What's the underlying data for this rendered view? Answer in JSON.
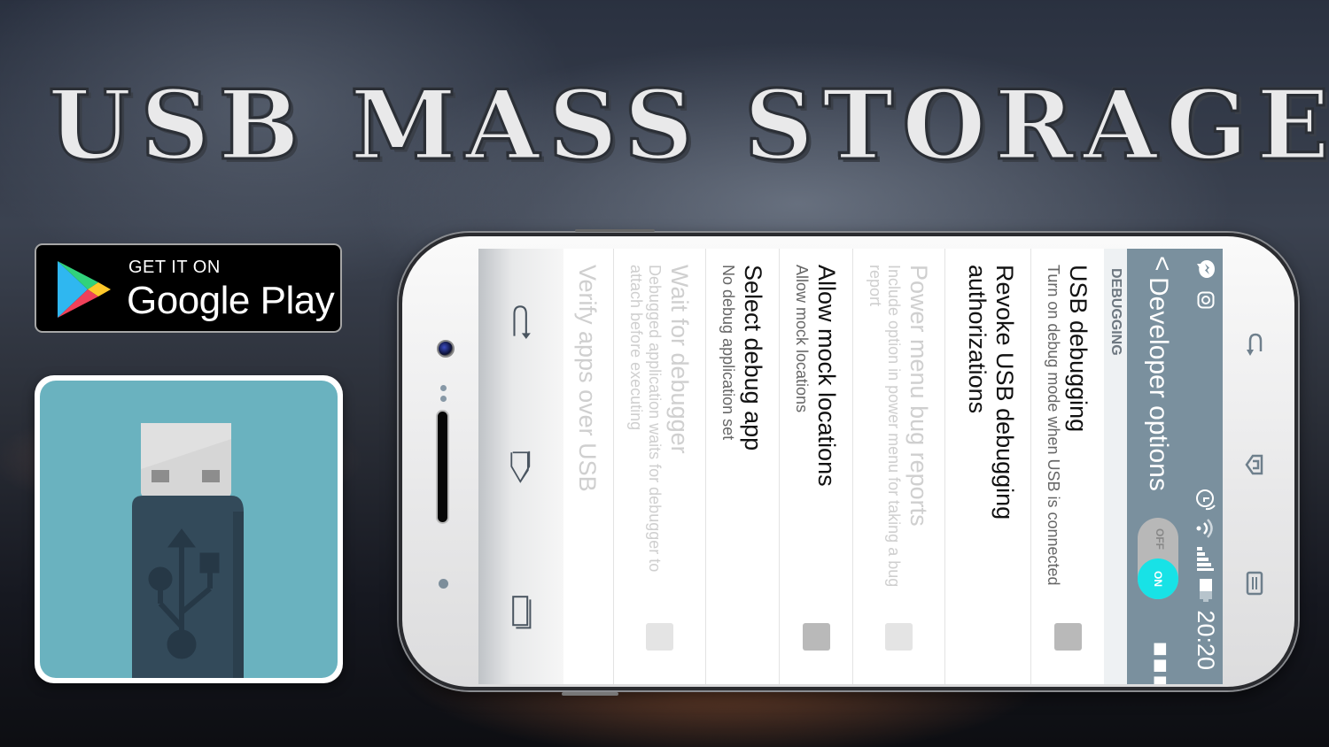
{
  "banner": {
    "title": "USB MASS STORAGE"
  },
  "store_badge": {
    "small_text": "GET IT ON",
    "big_text": "Google Play",
    "icon": "google-play-icon"
  },
  "app_icon": {
    "icon": "usb-drive-icon",
    "colors": {
      "background": "#6ab2bf",
      "body": "#334a5a",
      "connector": "#d6d6d6"
    }
  },
  "phone": {
    "status_bar": {
      "time": "20:20",
      "left_icons": [
        "messenger-icon",
        "instagram-icon"
      ],
      "right_icons": [
        "alarm-icon",
        "wifi-icon",
        "signal-icon",
        "battery-icon"
      ]
    },
    "app_bar": {
      "back_glyph": "<",
      "title": "Developer options",
      "toggle": {
        "off_label": "OFF",
        "on_label": "ON",
        "state": "on"
      },
      "overflow_icon": "more-icon"
    },
    "section_header": "DEBUGGING",
    "settings": [
      {
        "title": "USB debugging",
        "subtitle": "Turn on debug mode when USB is connected",
        "checkbox": true,
        "enabled": true
      },
      {
        "title": "Revoke USB debugging authorizations",
        "subtitle": "",
        "checkbox": false,
        "enabled": true
      },
      {
        "title": "Power menu bug reports",
        "subtitle": "Include option in power menu for taking a bug report",
        "checkbox": true,
        "enabled": false
      },
      {
        "title": "Allow mock locations",
        "subtitle": "Allow mock locations",
        "checkbox": true,
        "enabled": true
      },
      {
        "title": "Select debug app",
        "subtitle": "No debug application set",
        "checkbox": false,
        "enabled": true
      },
      {
        "title": "Wait for debugger",
        "subtitle": "Debugged application waits for debugger to attach before executing",
        "checkbox": true,
        "enabled": false
      },
      {
        "title": "Verify apps over USB",
        "subtitle": "",
        "checkbox": false,
        "enabled": false
      }
    ],
    "nav_bar": [
      "back-icon",
      "home-icon",
      "recents-icon"
    ],
    "hw_buttons": [
      "hw-back-icon",
      "hw-home-icon",
      "hw-menu-icon"
    ],
    "colors": {
      "status_bar": "#7a909e",
      "toggle_on": "#18e2e6"
    }
  }
}
